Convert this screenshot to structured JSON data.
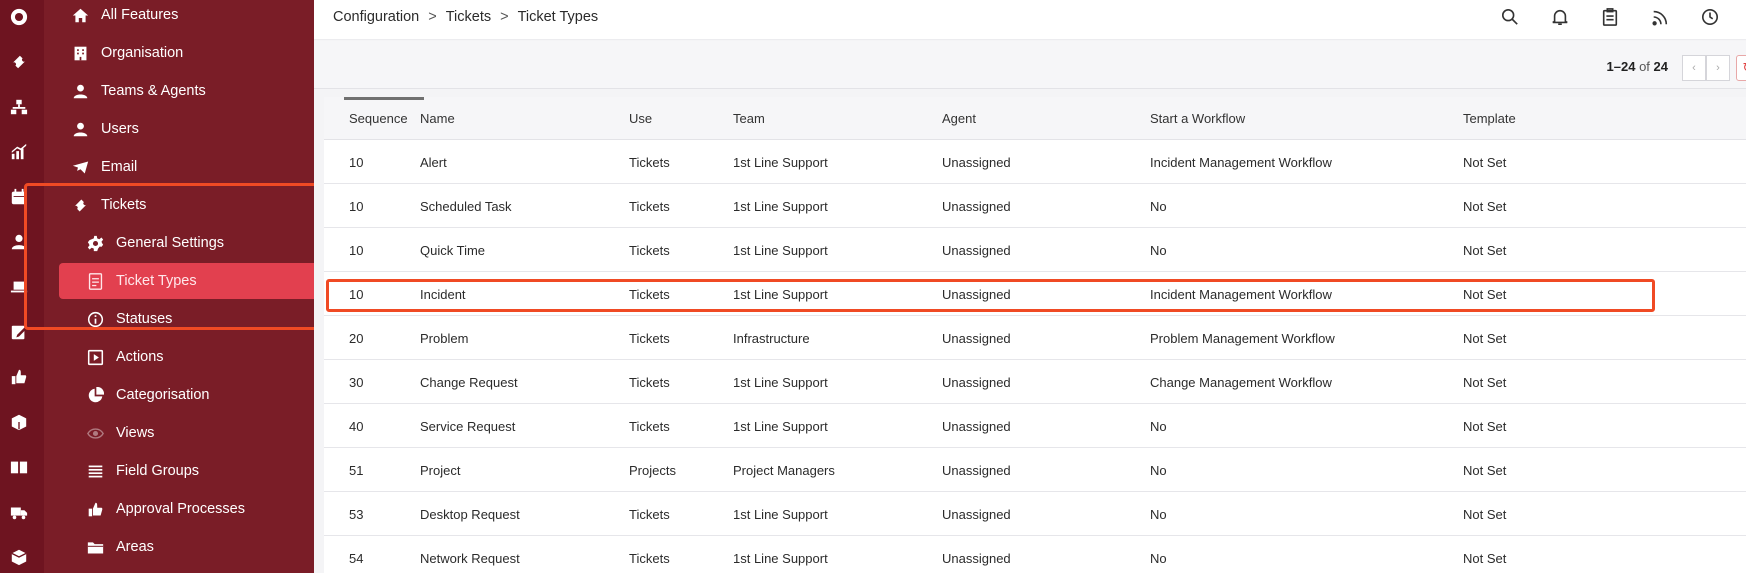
{
  "rail": {
    "icons": [
      "logo-icon",
      "ticket-icon",
      "org-chart-icon",
      "analytics-icon",
      "calendar-icon",
      "user-icon",
      "laptop-icon",
      "edit-icon",
      "thumbs-up-icon",
      "boxes-icon",
      "book-icon",
      "truck-icon",
      "package-icon"
    ]
  },
  "sidebar": {
    "items": [
      {
        "label": "All Features",
        "icon": "home-icon"
      },
      {
        "label": "Organisation",
        "icon": "building-icon"
      },
      {
        "label": "Teams & Agents",
        "icon": "user-icon"
      },
      {
        "label": "Users",
        "icon": "user-icon"
      },
      {
        "label": "Email",
        "icon": "email-icon"
      },
      {
        "label": "Tickets",
        "icon": "ticket-icon"
      },
      {
        "label": "General Settings",
        "icon": "gear-icon"
      },
      {
        "label": "Ticket Types",
        "icon": "document-icon",
        "active": true
      },
      {
        "label": "Statuses",
        "icon": "info-icon"
      },
      {
        "label": "Actions",
        "icon": "play-icon"
      },
      {
        "label": "Categorisation",
        "icon": "pie-chart-icon"
      },
      {
        "label": "Views",
        "icon": "eye-icon"
      },
      {
        "label": "Field Groups",
        "icon": "list-icon"
      },
      {
        "label": "Approval Processes",
        "icon": "thumbs-up-icon"
      },
      {
        "label": "Areas",
        "icon": "folder-icon"
      }
    ]
  },
  "header": {
    "breadcrumb": [
      "Configuration",
      "Tickets",
      "Ticket Types"
    ],
    "separator": ">",
    "icons": [
      "search-icon",
      "bell-icon",
      "clipboard-icon",
      "rss-icon",
      "clock-icon"
    ]
  },
  "pager": {
    "range": "1–24",
    "of": "of",
    "total": "24",
    "prev": "‹",
    "next": "›",
    "refresh": "↻"
  },
  "table": {
    "columns": [
      "Sequence",
      "Name",
      "Use",
      "Team",
      "Agent",
      "Start a Workflow",
      "Template"
    ],
    "rows": [
      [
        "10",
        "Alert",
        "Tickets",
        "1st Line Support",
        "Unassigned",
        "Incident Management Workflow",
        "Not Set"
      ],
      [
        "10",
        "Scheduled Task",
        "Tickets",
        "1st Line Support",
        "Unassigned",
        "No",
        "Not Set"
      ],
      [
        "10",
        "Quick Time",
        "Tickets",
        "1st Line Support",
        "Unassigned",
        "No",
        "Not Set"
      ],
      [
        "10",
        "Incident",
        "Tickets",
        "1st Line Support",
        "Unassigned",
        "Incident Management Workflow",
        "Not Set"
      ],
      [
        "20",
        "Problem",
        "Tickets",
        "Infrastructure",
        "Unassigned",
        "Problem Management Workflow",
        "Not Set"
      ],
      [
        "30",
        "Change Request",
        "Tickets",
        "1st Line Support",
        "Unassigned",
        "Change Management Workflow",
        "Not Set"
      ],
      [
        "40",
        "Service Request",
        "Tickets",
        "1st Line Support",
        "Unassigned",
        "No",
        "Not Set"
      ],
      [
        "51",
        "Project",
        "Projects",
        "Project Managers",
        "Unassigned",
        "No",
        "Not Set"
      ],
      [
        "53",
        "Desktop Request",
        "Tickets",
        "1st Line Support",
        "Unassigned",
        "No",
        "Not Set"
      ],
      [
        "54",
        "Network Request",
        "Tickets",
        "1st Line Support",
        "Unassigned",
        "No",
        "Not Set"
      ]
    ]
  },
  "colors": {
    "rail": "#6e1420",
    "sidebar": "#7a1d27",
    "active": "#e2404f",
    "highlight": "#f04a24"
  }
}
